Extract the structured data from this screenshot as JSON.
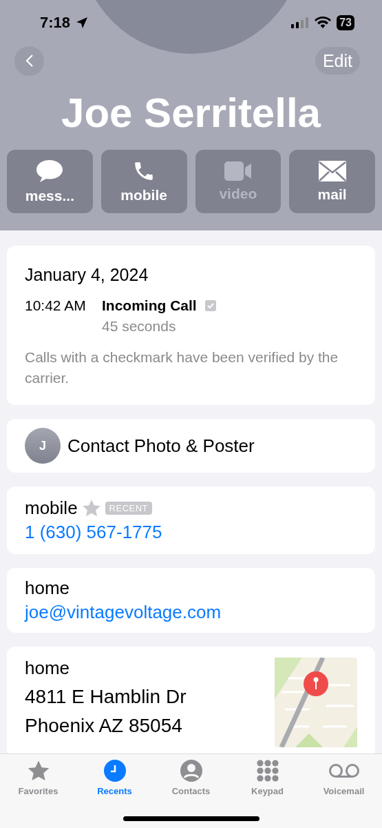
{
  "status_bar": {
    "time": "7:18",
    "battery": "73"
  },
  "header": {
    "edit_button": "Edit",
    "name": "Joe Serritella",
    "actions": [
      {
        "kind": "message",
        "label": "mess...",
        "disabled": false
      },
      {
        "kind": "phone",
        "label": "mobile",
        "disabled": false
      },
      {
        "kind": "video",
        "label": "video",
        "disabled": true
      },
      {
        "kind": "mail",
        "label": "mail",
        "disabled": false
      }
    ]
  },
  "call_card": {
    "date": "January 4, 2024",
    "time": "10:42 AM",
    "type": "Incoming Call",
    "verified": true,
    "duration": "45 seconds",
    "note": "Calls with a checkmark have been verified by the carrier."
  },
  "poster_card": {
    "initial": "J",
    "label": "Contact Photo & Poster"
  },
  "phone_card": {
    "label": "mobile",
    "badge": "RECENT",
    "number": "1 (630) 567-1775"
  },
  "email_card": {
    "label": "home",
    "value": "joe@vintagevoltage.com"
  },
  "address_card": {
    "label": "home",
    "lines": [
      "4811 E Hamblin Dr",
      "Phoenix AZ 85054"
    ]
  },
  "tab_bar": [
    {
      "kind": "favorites",
      "label": "Favorites",
      "selected": false
    },
    {
      "kind": "recents",
      "label": "Recents",
      "selected": true
    },
    {
      "kind": "contacts",
      "label": "Contacts",
      "selected": false
    },
    {
      "kind": "keypad",
      "label": "Keypad",
      "selected": false
    },
    {
      "kind": "voicemail",
      "label": "Voicemail",
      "selected": false
    }
  ]
}
